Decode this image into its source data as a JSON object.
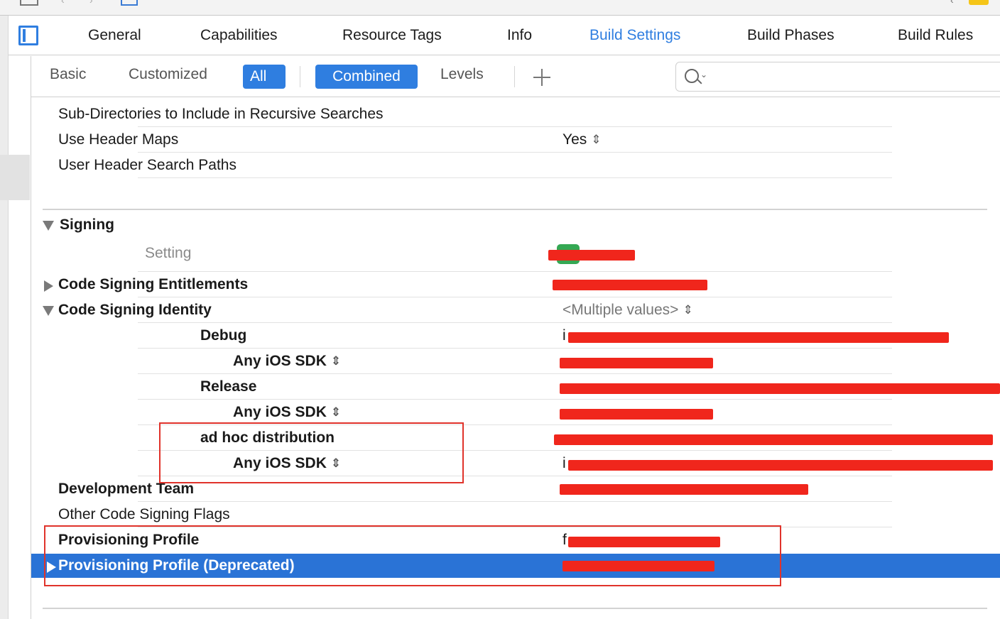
{
  "tabbar": {
    "tabs": [
      "General",
      "Capabilities",
      "Resource Tags",
      "Info",
      "Build Settings",
      "Build Phases",
      "Build Rules"
    ],
    "active_tab": "Build Settings"
  },
  "filter": {
    "basic": "Basic",
    "customized": "Customized",
    "all": "All",
    "combined": "Combined",
    "levels": "Levels"
  },
  "rows": {
    "subdirs": "Sub-Directories to Include in Recursive Searches",
    "use_header_maps": "Use Header Maps",
    "use_header_maps_value": "Yes",
    "user_header_search_paths": "User Header Search Paths",
    "signing_section": "Signing",
    "setting_column": "Setting",
    "code_signing_entitlements": "Code Signing Entitlements",
    "code_signing_identity": "Code Signing Identity",
    "code_signing_identity_value": "<Multiple values>",
    "debug": "Debug",
    "any_ios_sdk": "Any iOS SDK",
    "release": "Release",
    "ad_hoc": "ad hoc distribution",
    "development_team": "Development Team",
    "other_code_signing_flags": "Other Code Signing Flags",
    "provisioning_profile": "Provisioning Profile",
    "provisioning_profile_deprecated": "Provisioning Profile (Deprecated)",
    "provisioning_profile_value_partial": "f",
    "identity_value_partial": "i"
  },
  "colors": {
    "accent": "#2f7ee0",
    "selection": "#2a73d6",
    "redaction": "#f0261c",
    "annotation_box": "#e0332b"
  }
}
